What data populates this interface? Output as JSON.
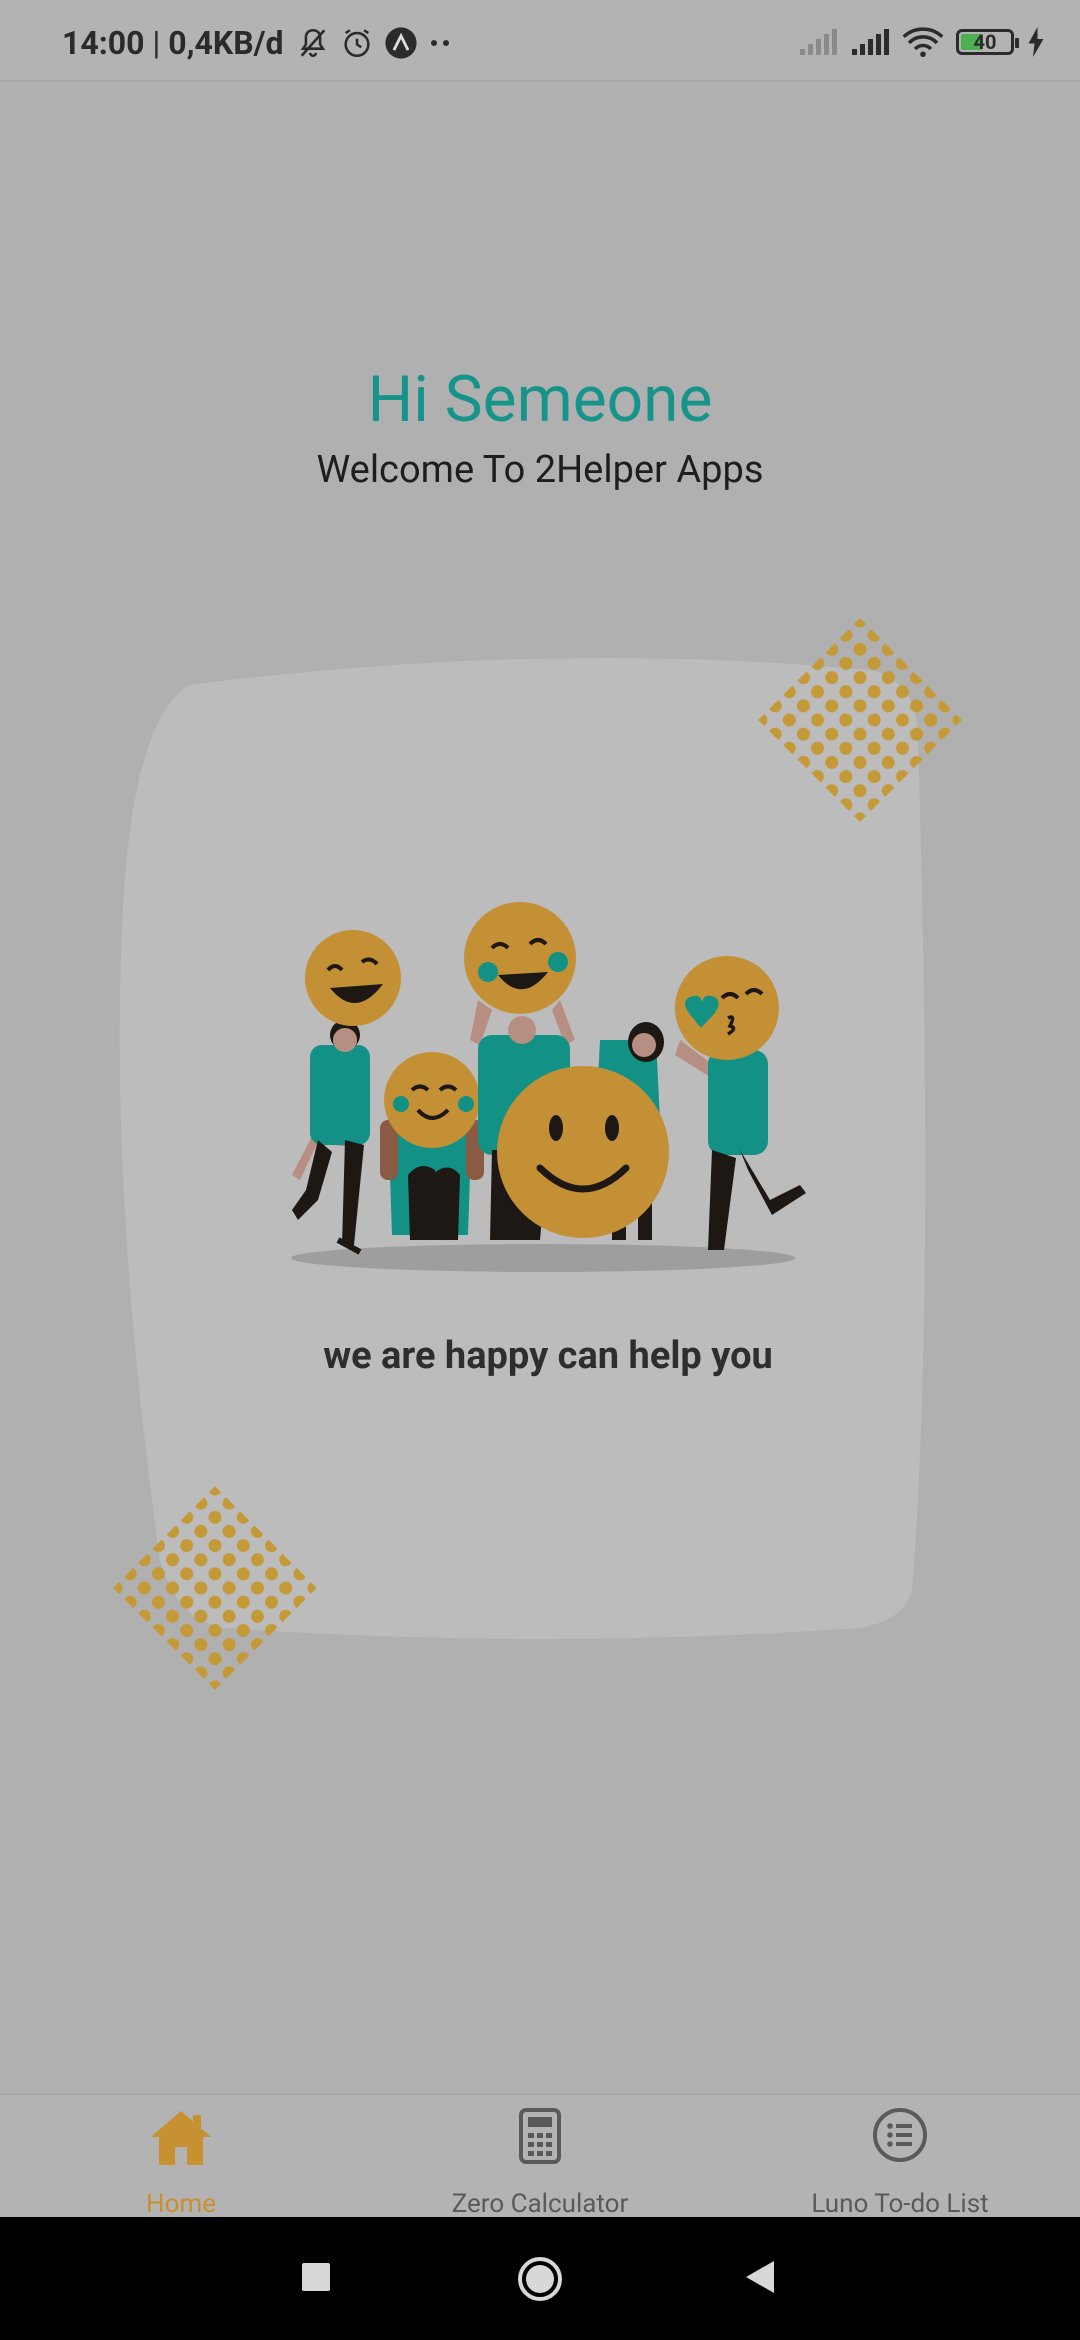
{
  "status_bar": {
    "time": "14:00",
    "network_speed": "0,4KB/d",
    "battery_level": "40",
    "icons": [
      "bell-off-icon",
      "alarm-icon",
      "app-icon",
      "more-dots-icon",
      "signal-icon",
      "signal-icon",
      "wifi-icon",
      "battery-icon",
      "charging-icon"
    ]
  },
  "greeting": {
    "title": "Hi Semeone",
    "subtitle": "Welcome To 2Helper Apps"
  },
  "illustration": {
    "caption": "we are happy can help you"
  },
  "bottom_nav": {
    "items": [
      {
        "label": "Home",
        "icon": "home-icon",
        "active": true
      },
      {
        "label": "Zero Calculator",
        "icon": "calculator-icon",
        "active": false
      },
      {
        "label": "Luno To-do List",
        "icon": "list-icon",
        "active": false
      }
    ]
  },
  "colors": {
    "background": "#b0b0b0",
    "accent_teal": "#16948a",
    "accent_gold": "#c79031",
    "card": "#bcbcbc"
  }
}
